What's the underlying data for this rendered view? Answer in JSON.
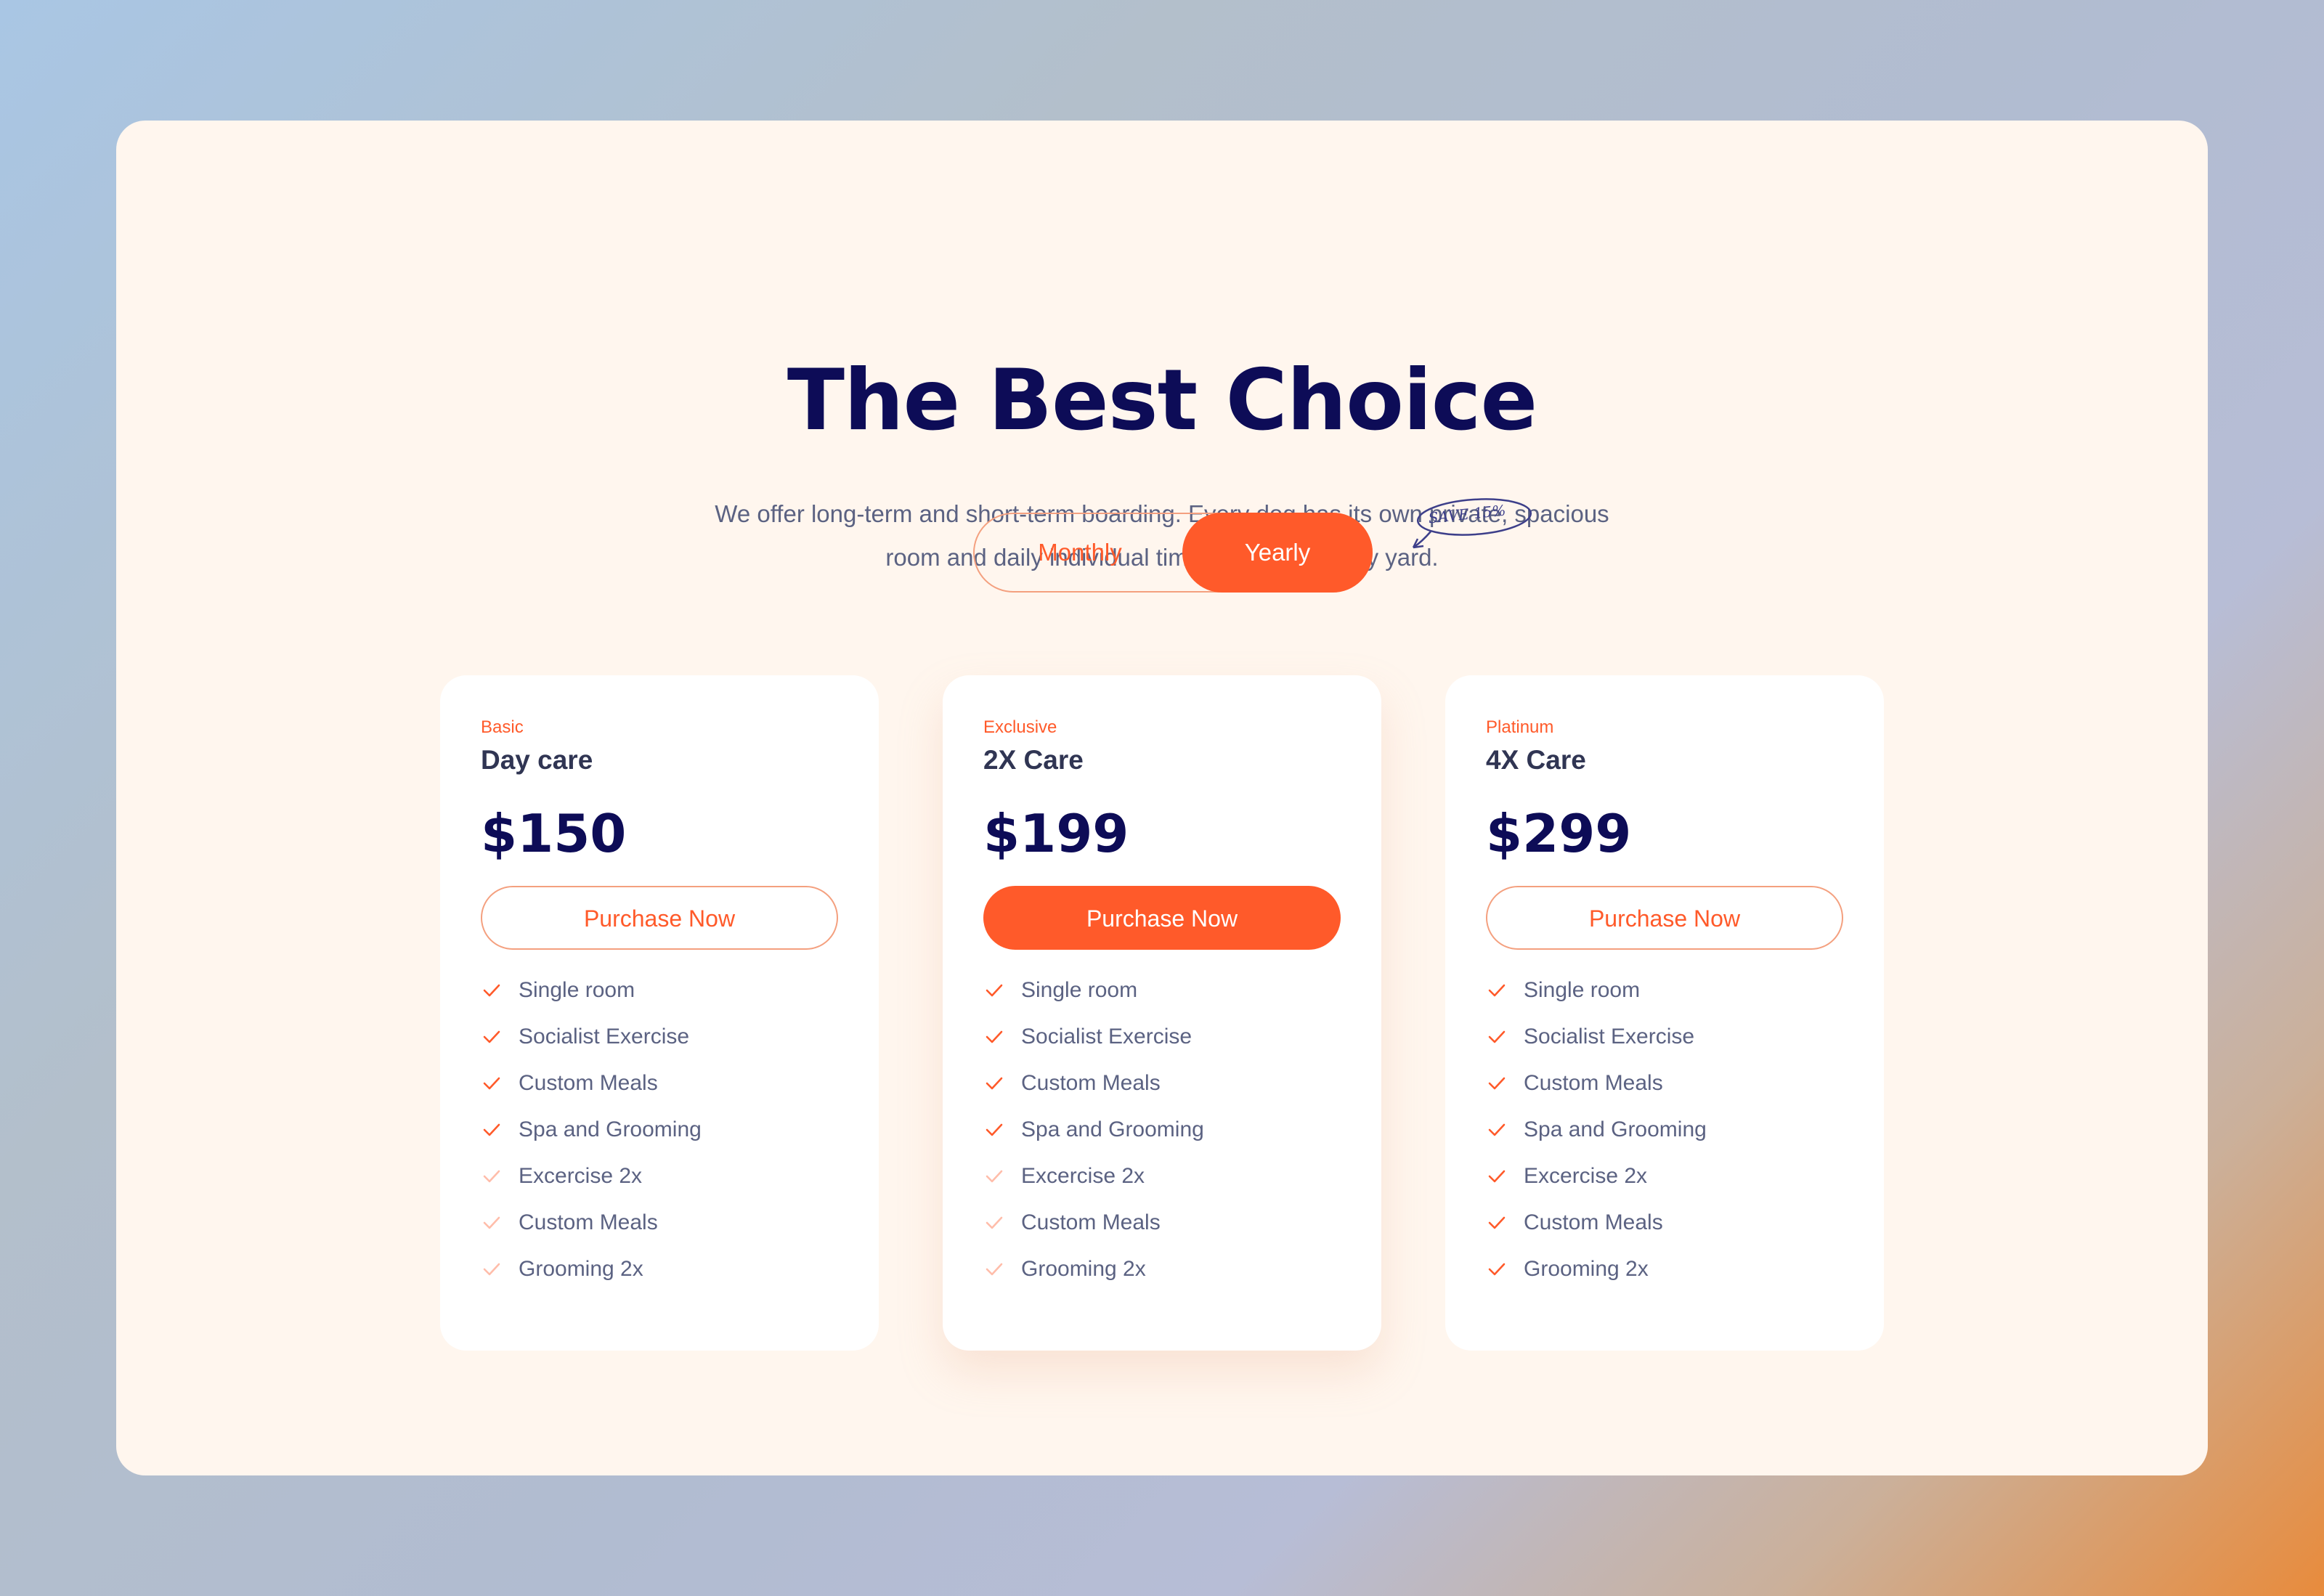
{
  "page": {
    "title": "The Best Choice",
    "subtitle_line1": "We offer long-term and short-term boarding. Every dog has its own private, spacious",
    "subtitle_line2": "room and daily individual time in our large play yard."
  },
  "billing_toggle": {
    "monthly_label": "Monthly",
    "yearly_label": "Yearly",
    "selected": "Yearly",
    "save_badge": "SAVE 15%"
  },
  "colors": {
    "accent": "#ff5a2a",
    "heading": "#0d0c57",
    "panel": "#fff6ee"
  },
  "plans": [
    {
      "tier": "Basic",
      "name": "Day care",
      "price": "$150",
      "button_label": "Purchase Now",
      "features": [
        {
          "label": "Single room",
          "included": true
        },
        {
          "label": "Socialist Exercise",
          "included": true
        },
        {
          "label": "Custom Meals",
          "included": true
        },
        {
          "label": "Spa and Grooming",
          "included": true
        },
        {
          "label": "Excercise 2x",
          "included": false
        },
        {
          "label": "Custom Meals",
          "included": false
        },
        {
          "label": "Grooming 2x",
          "included": false
        }
      ]
    },
    {
      "tier": "Exclusive",
      "name": "2X Care",
      "price": "$199",
      "button_label": "Purchase Now",
      "features": [
        {
          "label": "Single room",
          "included": true
        },
        {
          "label": "Socialist Exercise",
          "included": true
        },
        {
          "label": "Custom Meals",
          "included": true
        },
        {
          "label": "Spa and Grooming",
          "included": true
        },
        {
          "label": "Excercise 2x",
          "included": false
        },
        {
          "label": "Custom Meals",
          "included": false
        },
        {
          "label": "Grooming 2x",
          "included": false
        }
      ]
    },
    {
      "tier": "Platinum",
      "name": "4X Care",
      "price": "$299",
      "button_label": "Purchase Now",
      "features": [
        {
          "label": "Single room",
          "included": true
        },
        {
          "label": "Socialist Exercise",
          "included": true
        },
        {
          "label": "Custom Meals",
          "included": true
        },
        {
          "label": "Spa and Grooming",
          "included": true
        },
        {
          "label": "Excercise 2x",
          "included": true
        },
        {
          "label": "Custom Meals",
          "included": true
        },
        {
          "label": "Grooming 2x",
          "included": true
        }
      ]
    }
  ]
}
